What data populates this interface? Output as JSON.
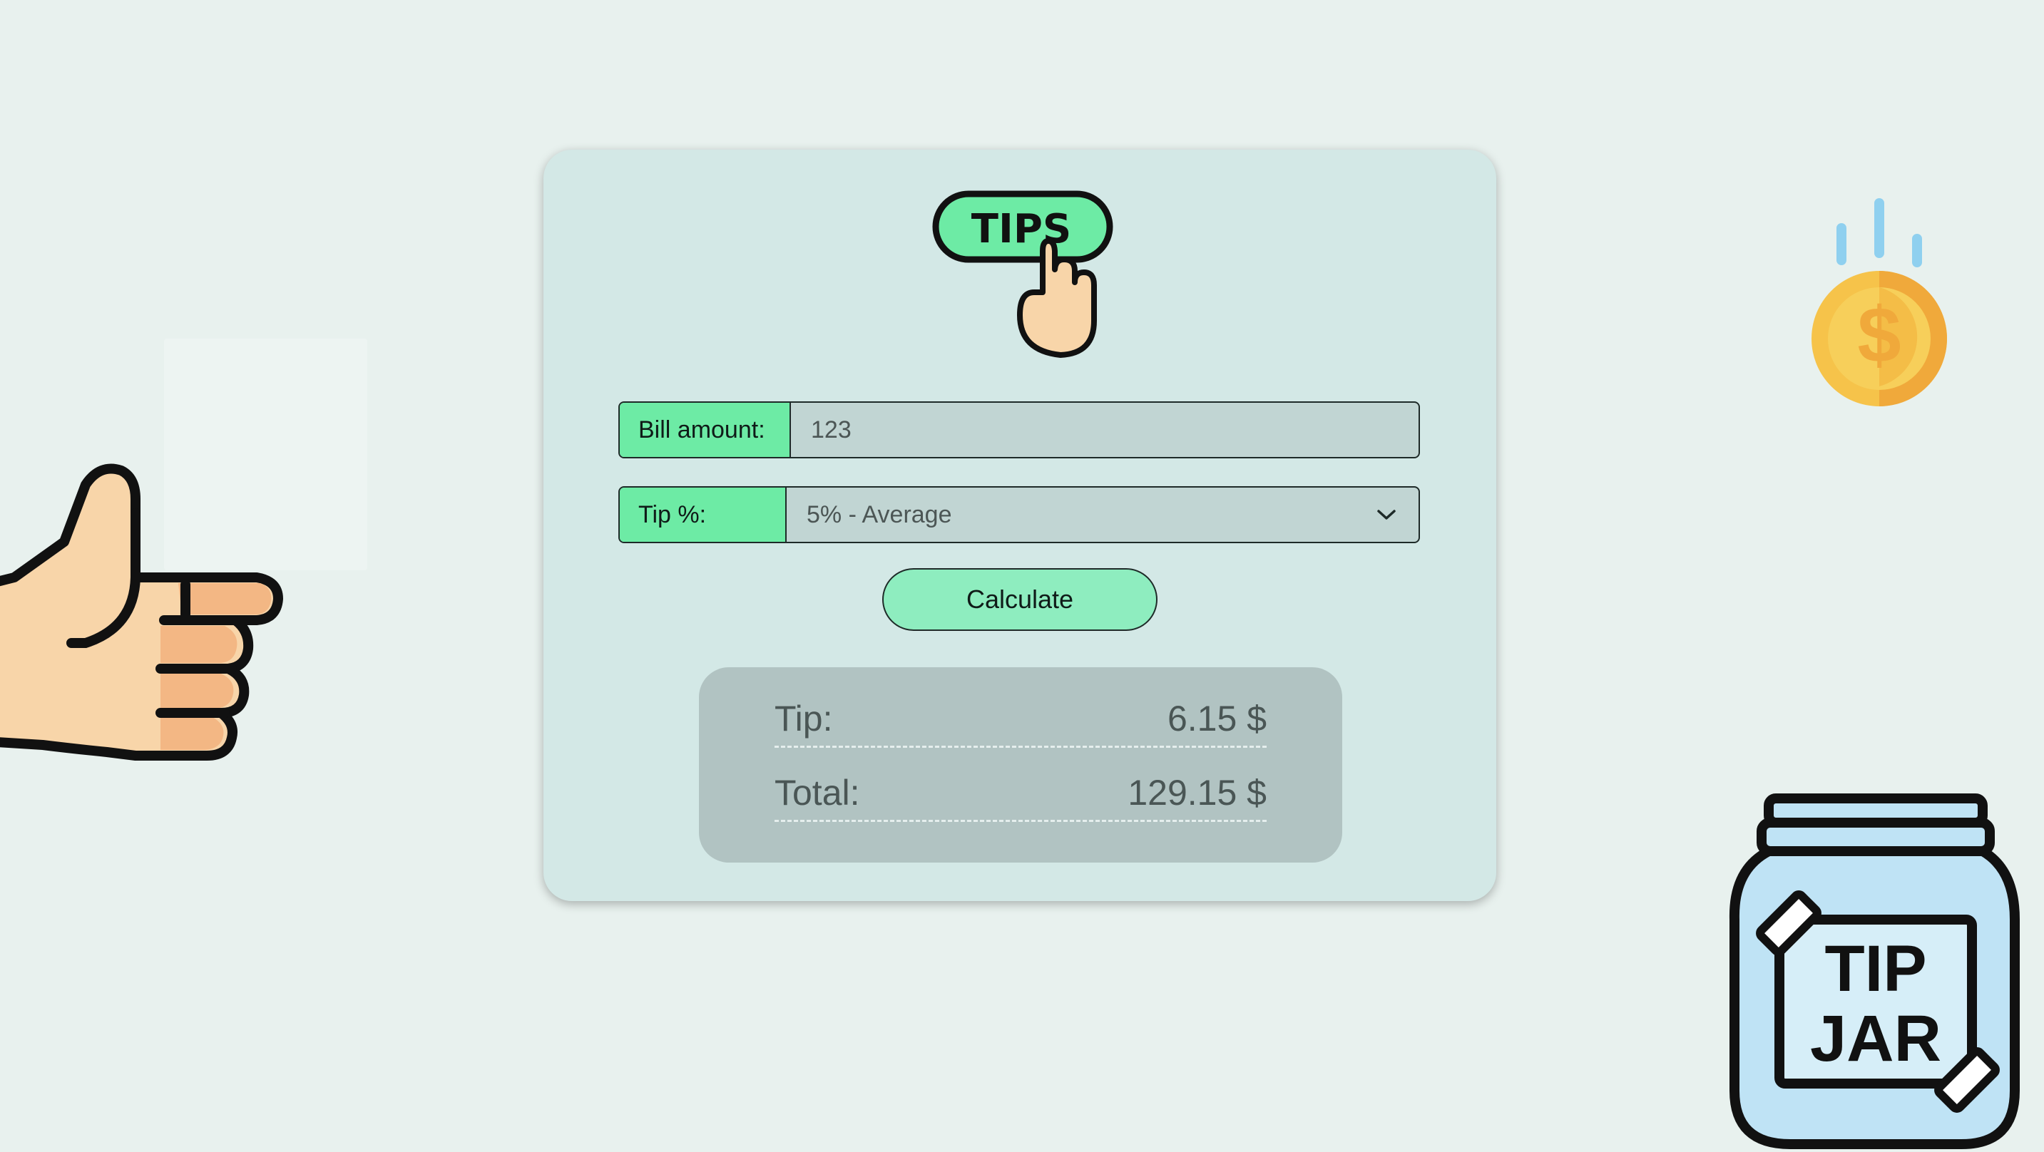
{
  "logo": {
    "text": "TIPS"
  },
  "form": {
    "bill_label": "Bill amount:",
    "bill_value": "123",
    "tip_label": "Tip %:",
    "tip_selected": "5% - Average",
    "calculate_label": "Calculate"
  },
  "results": {
    "tip_label": "Tip:",
    "tip_value": "6.15 $",
    "total_label": "Total:",
    "total_value": "129.15 $"
  },
  "decorations": {
    "jar_line1": "TIP",
    "jar_line2": "JAR",
    "icons": [
      "pointing-thumbs-up-icon",
      "falling-coin-icon",
      "tip-jar-icon",
      "tips-button-hand-icon",
      "chevron-down-icon"
    ]
  },
  "colors": {
    "background": "#e8f1ee",
    "card": "#d3e8e6",
    "accent_green": "#6deba5",
    "button_green": "#8eedbf",
    "results_panel": "#b1c3c2"
  }
}
